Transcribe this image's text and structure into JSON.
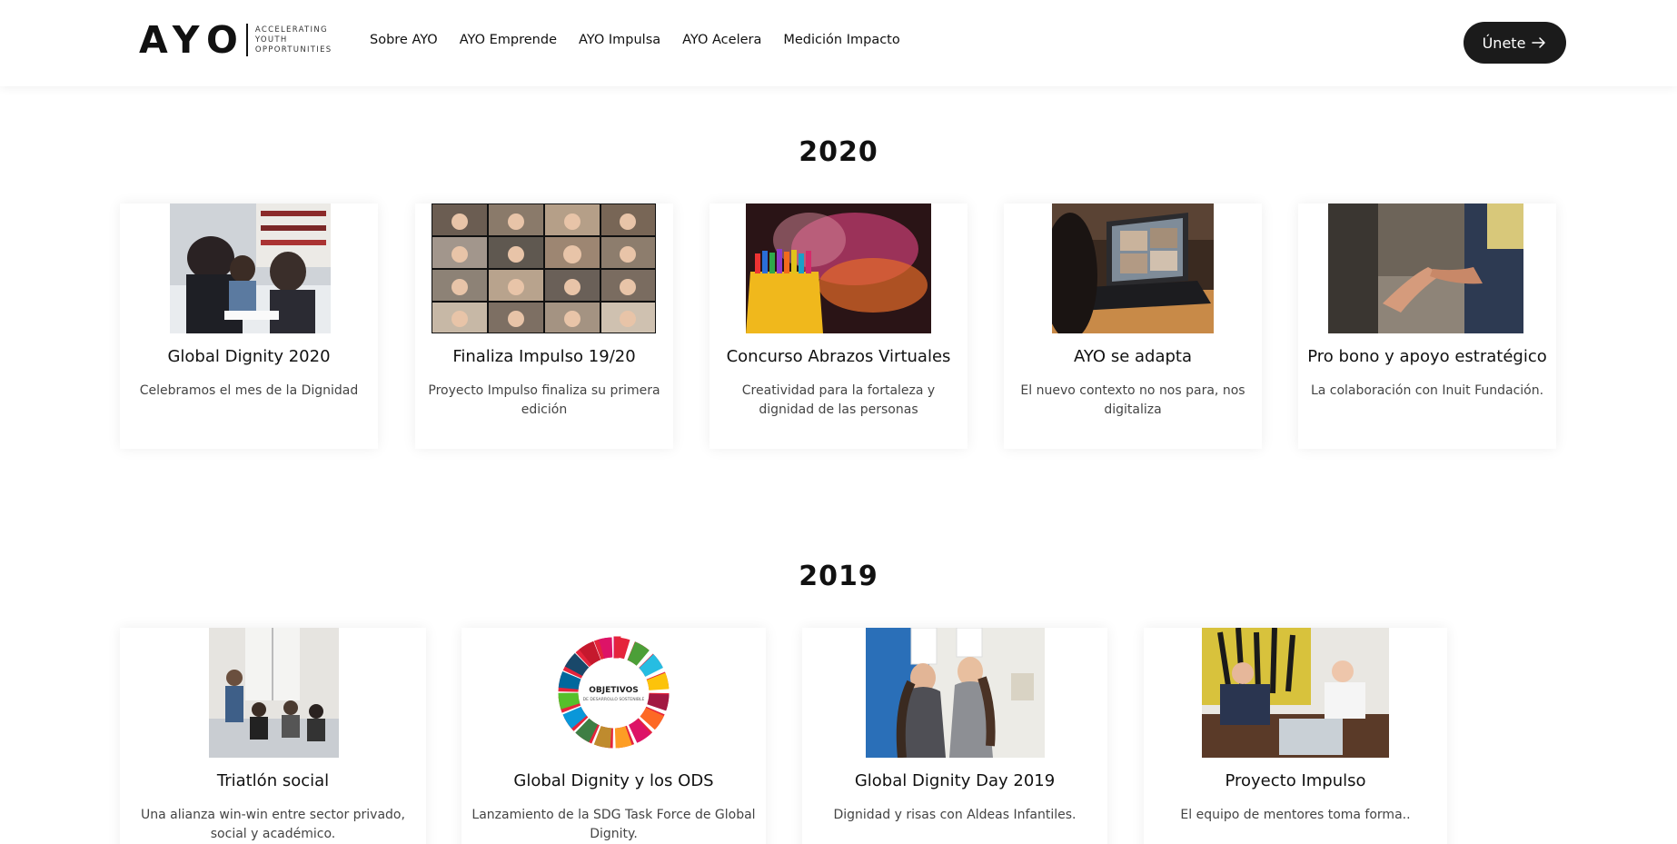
{
  "header": {
    "logo_word": "AYO",
    "logo_tagline": [
      "ACCELERATING",
      "YOUTH",
      "OPPORTUNITIES"
    ],
    "nav": [
      "Sobre AYO",
      "AYO Emprende",
      "AYO Impulsa",
      "AYO Acelera",
      "Medición Impacto"
    ],
    "join_label": "Únete"
  },
  "sections": [
    {
      "year": "2020",
      "cards": [
        {
          "title": "Global Dignity 2020",
          "desc": "Celebramos el mes de la Dignidad",
          "image": "students-meeting-photo"
        },
        {
          "title": "Finaliza Impulso 19/20",
          "desc": "Proyecto Impulso finaliza su primera edición",
          "image": "video-call-grid-photo"
        },
        {
          "title": "Concurso Abrazos Virtuales",
          "desc": "Creatividad para la fortaleza y dignidad de las personas",
          "image": "crayons-photo"
        },
        {
          "title": "AYO se adapta",
          "desc": "El nuevo contexto no nos para, nos digitaliza",
          "image": "laptop-video-call-photo"
        },
        {
          "title": "Pro bono y apoyo estratégico",
          "desc": "La colaboración con Inuit Fundación.",
          "image": "hands-high-five-photo"
        }
      ]
    },
    {
      "year": "2019",
      "cards": [
        {
          "title": "Triatlón social",
          "desc": "Una alianza win-win entre sector privado, social y académico.",
          "image": "office-meeting-photo"
        },
        {
          "title": "Global Dignity y los ODS",
          "desc": "Lanzamiento de la SDG Task Force de Global Dignity.",
          "image": "sdg-wheel-logo",
          "logo_text": [
            "OBJETIVOS",
            "DE DESARROLLO SOSTENIBLE"
          ]
        },
        {
          "title": "Global Dignity Day 2019",
          "desc": "Dignidad y risas con Aldeas Infantiles.",
          "image": "chef-hats-photo"
        },
        {
          "title": "Proyecto Impulso",
          "desc": "El equipo de mentores toma forma..",
          "image": "mentors-table-photo"
        }
      ]
    }
  ],
  "colors": {
    "accent": "#1b1b1b",
    "background": "#ffffff",
    "text": "#111111",
    "muted": "#444444"
  }
}
